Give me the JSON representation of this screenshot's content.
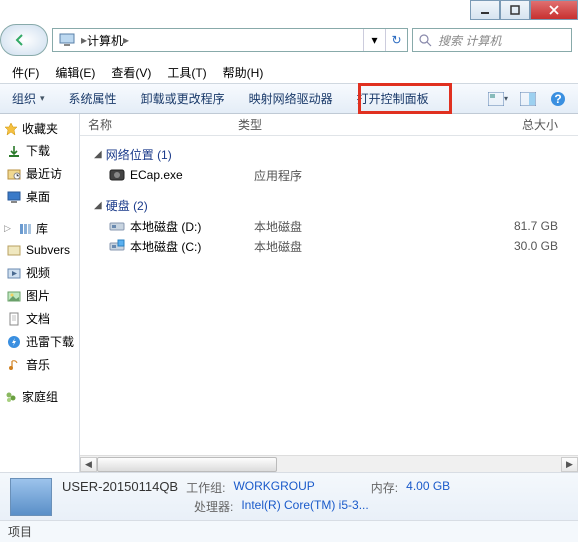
{
  "window": {
    "min": "−",
    "max": "▢",
    "close": "✕"
  },
  "address": {
    "root_label": "计算机",
    "dropdown": "▾",
    "refresh": "↻"
  },
  "search": {
    "placeholder": "搜索 计算机"
  },
  "menu": {
    "file": "件(F)",
    "edit": "编辑(E)",
    "view": "查看(V)",
    "tools": "工具(T)",
    "help": "帮助(H)"
  },
  "toolbar": {
    "organize": "组织",
    "properties": "系统属性",
    "uninstall": "卸载或更改程序",
    "mapdrive": "映射网络驱动器",
    "controlpanel": "打开控制面板"
  },
  "sidebar": {
    "favorites": {
      "label": "收藏夹",
      "items": [
        {
          "icon": "download",
          "label": "下载"
        },
        {
          "icon": "recent",
          "label": "最近访"
        },
        {
          "icon": "desktop",
          "label": "桌面"
        }
      ]
    },
    "libraries": {
      "label": "库",
      "items": [
        {
          "icon": "svn",
          "label": "Subvers"
        },
        {
          "icon": "video",
          "label": "视频"
        },
        {
          "icon": "picture",
          "label": "图片"
        },
        {
          "icon": "document",
          "label": "文档"
        },
        {
          "icon": "thunder",
          "label": "迅雷下载"
        },
        {
          "icon": "music",
          "label": "音乐"
        }
      ]
    },
    "homegroup": {
      "label": "家庭组"
    }
  },
  "columns": {
    "name": "名称",
    "type": "类型",
    "totalsize": "总大小"
  },
  "groups": [
    {
      "name": "网络位置",
      "count": "(1)",
      "items": [
        {
          "icon": "exe",
          "name": "ECap.exe",
          "type": "应用程序",
          "size": ""
        }
      ]
    },
    {
      "name": "硬盘",
      "count": "(2)",
      "items": [
        {
          "icon": "disk",
          "name": "本地磁盘 (D:)",
          "type": "本地磁盘",
          "size": "81.7 GB"
        },
        {
          "icon": "sysdisk",
          "name": "本地磁盘 (C:)",
          "type": "本地磁盘",
          "size": "30.0 GB"
        }
      ]
    }
  ],
  "details": {
    "computer_name": "USER-20150114QB",
    "workgroup_k": "工作组:",
    "workgroup_v": "WORKGROUP",
    "cpu_k": "处理器:",
    "cpu_v": "Intel(R) Core(TM) i5-3...",
    "mem_k": "内存:",
    "mem_v": "4.00 GB"
  },
  "status": {
    "label": "项目"
  }
}
